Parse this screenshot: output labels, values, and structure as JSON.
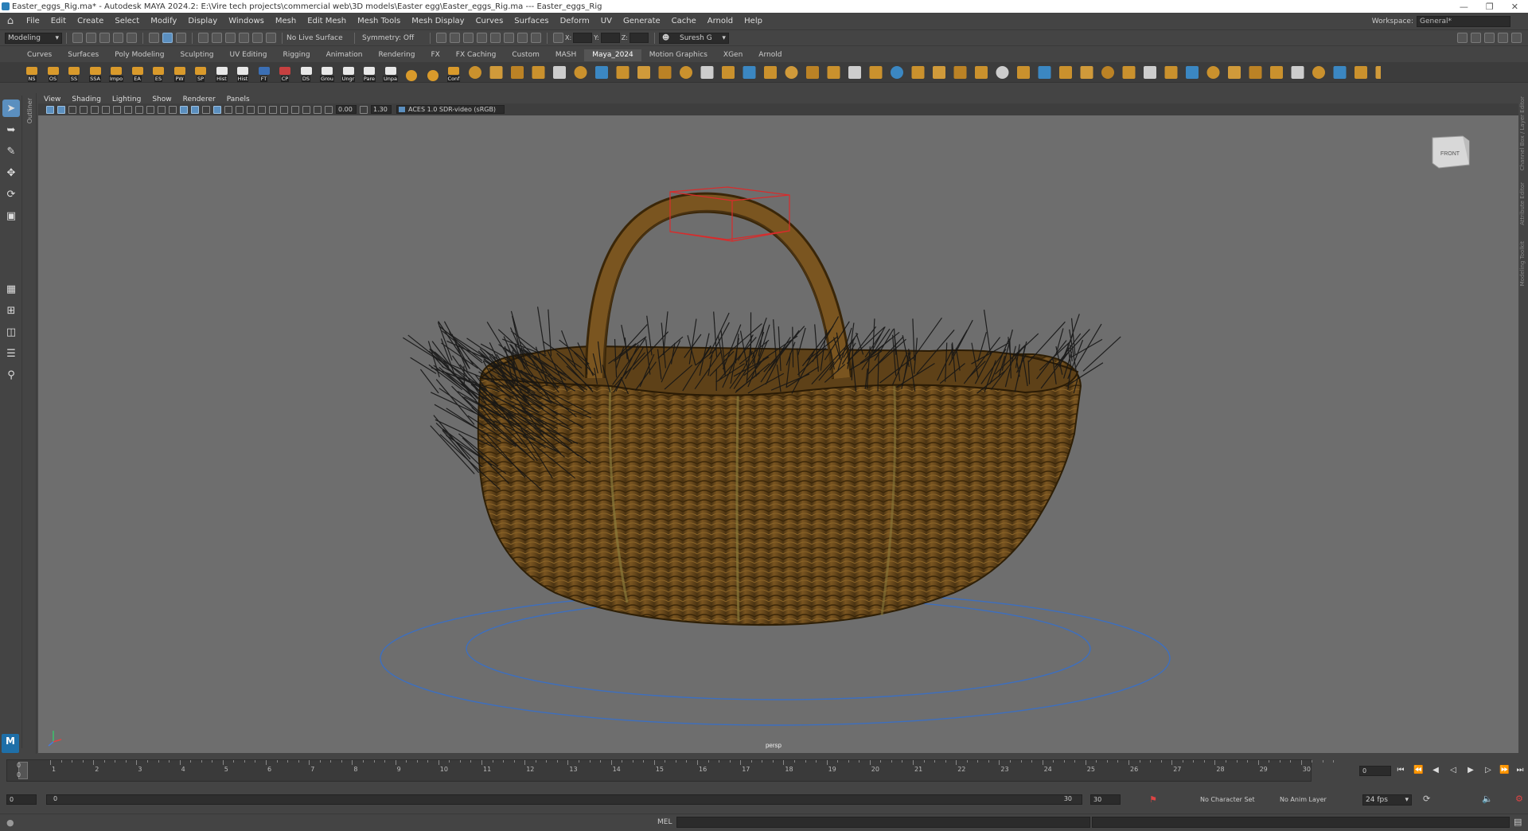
{
  "window": {
    "title": "Easter_eggs_Rig.ma* - Autodesk MAYA 2024.2: E:\\Vire tech projects\\commercial web\\3D models\\Easter egg\\Easter_eggs_Rig.ma    ---    Easter_eggs_Rig"
  },
  "menubar": {
    "items": [
      "File",
      "Edit",
      "Create",
      "Select",
      "Modify",
      "Display",
      "Windows",
      "Mesh",
      "Edit Mesh",
      "Mesh Tools",
      "Mesh Display",
      "Curves",
      "Surfaces",
      "Deform",
      "UV",
      "Generate",
      "Cache",
      "Arnold",
      "Help"
    ],
    "workspace_label": "Workspace:",
    "workspace_value": "General*"
  },
  "statusline": {
    "mode": "Modeling",
    "live_surface": "No Live Surface",
    "symmetry": "Symmetry: Off",
    "x_label": "X:",
    "y_label": "Y:",
    "z_label": "Z:",
    "user": "Suresh G"
  },
  "shelf": {
    "tabs": [
      "Curves",
      "Surfaces",
      "Poly Modeling",
      "Sculpting",
      "UV Editing",
      "Rigging",
      "Animation",
      "Rendering",
      "FX",
      "FX Caching",
      "Custom",
      "MASH",
      "Maya_2024",
      "Motion Graphics",
      "XGen",
      "Arnold"
    ],
    "active_tab": "Maya_2024",
    "buttons": [
      "NS",
      "OS",
      "SS",
      "SSA",
      "Impo",
      "EA",
      "ES",
      "PW",
      "SP",
      "Hist",
      "Hist",
      "FT",
      "CP",
      "DS",
      "Grou",
      "Ungr",
      "Pare",
      "Unpa",
      "",
      "",
      "Conf"
    ]
  },
  "panel": {
    "menus": [
      "View",
      "Shading",
      "Lighting",
      "Show",
      "Renderer",
      "Panels"
    ],
    "exposure": "0.00",
    "gamma": "1.30",
    "color_space": "ACES 1.0 SDR-video (sRGB)"
  },
  "viewport": {
    "camera_label": "persp",
    "viewcube_label": "FRONT"
  },
  "side_labels": {
    "outliner": "Outliner",
    "right": [
      "Channel Box / Layer Editor",
      "Attribute Editor",
      "Modeling Toolkit"
    ]
  },
  "timeline": {
    "ticks": [
      "1",
      "2",
      "3",
      "4",
      "5",
      "6",
      "7",
      "8",
      "9",
      "10",
      "11",
      "12",
      "13",
      "14",
      "15",
      "16",
      "17",
      "18",
      "19",
      "20",
      "21",
      "22",
      "23",
      "24",
      "25",
      "26",
      "27",
      "28",
      "29",
      "30"
    ],
    "start_marker": "0",
    "start_marker_b": "0",
    "current_frame": "0"
  },
  "range": {
    "start": "0",
    "inner_start": "0",
    "inner_end": "30",
    "end": "30",
    "character_set": "No Character Set",
    "anim_layer": "No Anim Layer",
    "fps": "24 fps"
  },
  "cmdline": {
    "lang": "MEL"
  },
  "colors": {
    "basket": "#6b4a1c",
    "selection": "#d92b2b",
    "curve": "#3d6fbf",
    "viewport_bg": "#6e6e6e"
  }
}
